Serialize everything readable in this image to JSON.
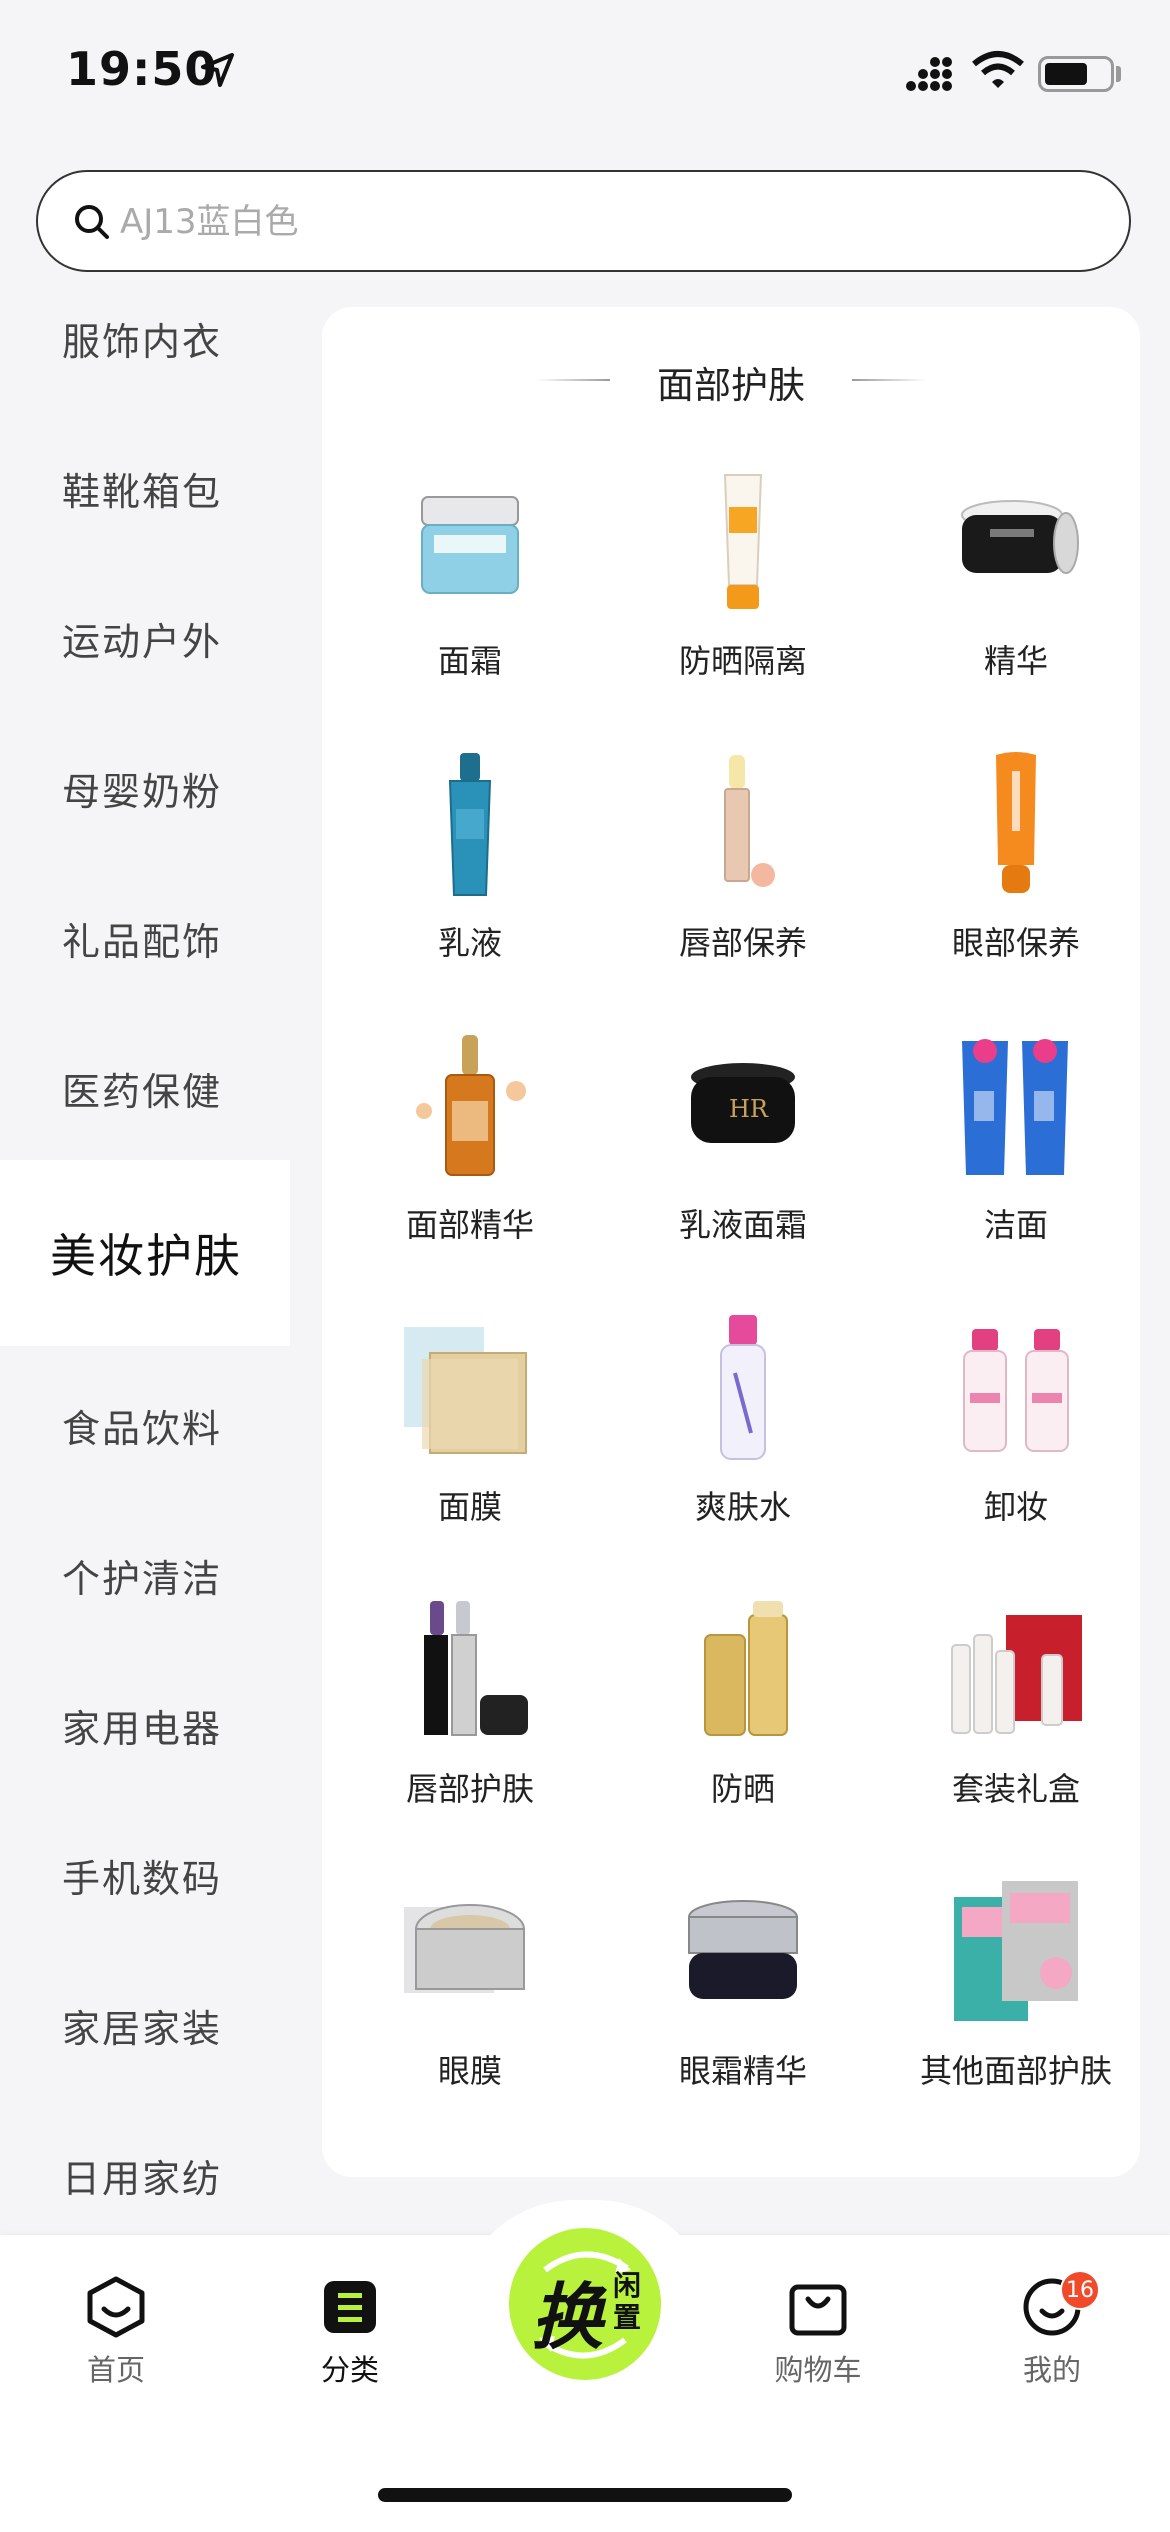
{
  "status_bar": {
    "time": "19:50"
  },
  "search": {
    "placeholder": "AJ13蓝白色"
  },
  "sidebar": {
    "items": [
      {
        "label": "服饰内衣"
      },
      {
        "label": "鞋靴箱包"
      },
      {
        "label": "运动户外"
      },
      {
        "label": "母婴奶粉"
      },
      {
        "label": "礼品配饰"
      },
      {
        "label": "医药保健"
      },
      {
        "label": "美妆护肤",
        "active": true
      },
      {
        "label": "食品饮料"
      },
      {
        "label": "个护清洁"
      },
      {
        "label": "家用电器"
      },
      {
        "label": "手机数码"
      },
      {
        "label": "家居家装"
      },
      {
        "label": "日用家纺"
      }
    ]
  },
  "panel": {
    "title": "面部护肤",
    "items": [
      {
        "label": "面霜",
        "icon": "cream-jar-icon"
      },
      {
        "label": "防晒隔离",
        "icon": "sunscreen-tube-icon"
      },
      {
        "label": "精华",
        "icon": "essence-jar-icon"
      },
      {
        "label": "乳液",
        "icon": "lotion-bottle-icon"
      },
      {
        "label": "唇部保养",
        "icon": "lip-balm-icon"
      },
      {
        "label": "眼部保养",
        "icon": "eye-care-tube-icon"
      },
      {
        "label": "面部精华",
        "icon": "serum-dropper-icon"
      },
      {
        "label": "乳液面霜",
        "icon": "black-cream-jar-icon"
      },
      {
        "label": "洁面",
        "icon": "cleanser-tubes-icon"
      },
      {
        "label": "面膜",
        "icon": "sheet-mask-icon"
      },
      {
        "label": "爽肤水",
        "icon": "toner-bottle-icon"
      },
      {
        "label": "卸妆",
        "icon": "micellar-water-icon"
      },
      {
        "label": "唇部护肤",
        "icon": "lipstick-icon"
      },
      {
        "label": "防晒",
        "icon": "sunscreen-bottle-icon"
      },
      {
        "label": "套装礼盒",
        "icon": "gift-set-icon"
      },
      {
        "label": "眼膜",
        "icon": "eye-mask-jar-icon"
      },
      {
        "label": "眼霜精华",
        "icon": "eye-cream-jar-icon"
      },
      {
        "label": "其他面部护肤",
        "icon": "mask-pack-icon"
      }
    ]
  },
  "tabbar": {
    "home": "首页",
    "category": "分类",
    "center_main": "换",
    "center_sub": "闲置",
    "cart": "购物车",
    "mine": "我的",
    "mine_badge": "16",
    "accent": "#b9f23c",
    "badge_color": "#f04a2a"
  }
}
